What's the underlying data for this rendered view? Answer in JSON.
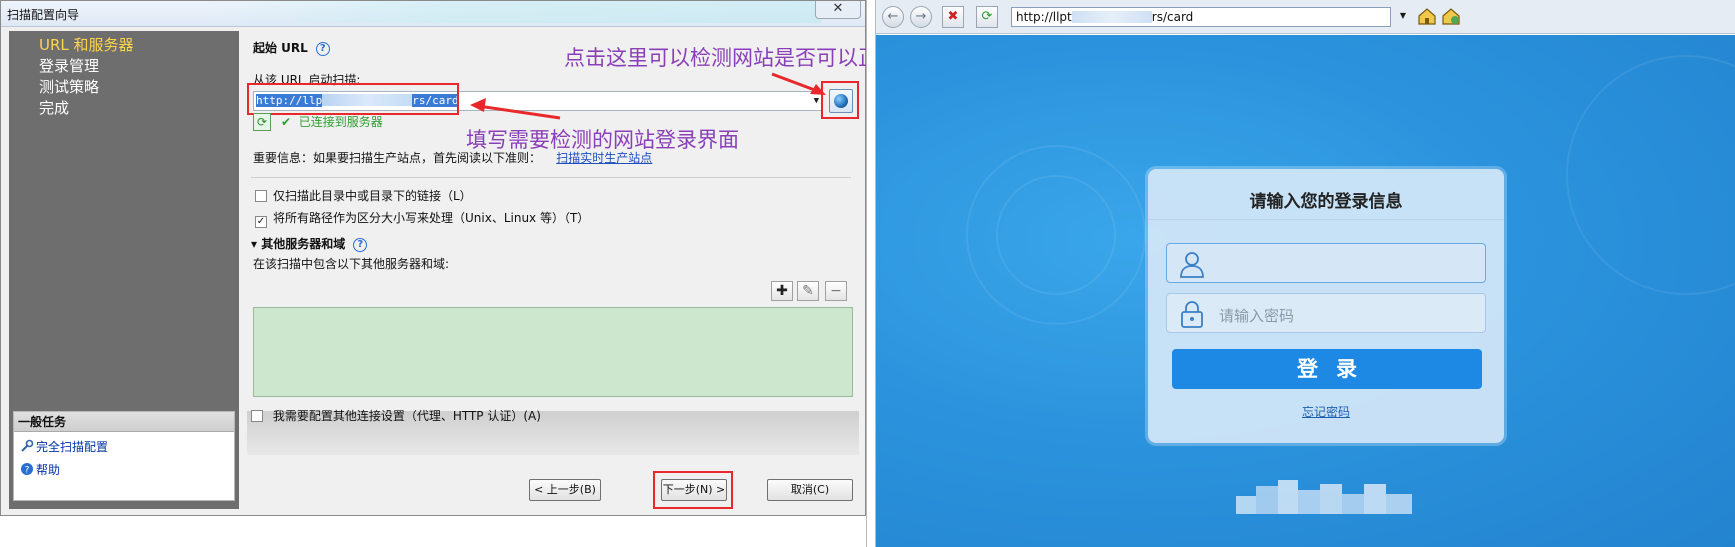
{
  "wizard": {
    "title": "扫描配置向导",
    "close_label": "✕",
    "steps": [
      "URL 和服务器",
      "登录管理",
      "测试策略",
      "完成"
    ],
    "general_tasks": {
      "header": "一般任务",
      "items": [
        {
          "label": "完全扫描配置",
          "icon": "wrench-icon"
        },
        {
          "label": "帮助",
          "icon": "help-icon"
        }
      ]
    },
    "start_url": {
      "heading": "起始 URL",
      "from_label": "从该 URL 启动扫描:",
      "url_prefix": "http://llp",
      "url_suffix": "rs/card",
      "connected_status": "已连接到服务器"
    },
    "important_info": {
      "text": "重要信息：如果要扫描生产站点，首先阅读以下准则：",
      "link": "扫描实时生产站点"
    },
    "options": [
      {
        "label": "仅扫描此目录中或目录下的链接（L）",
        "checked": false
      },
      {
        "label": "将所有路径作为区分大小写来处理（Unix、Linux 等）（T）",
        "checked": true
      }
    ],
    "other_servers": {
      "heading": "其他服务器和域",
      "description": "在该扫描中包含以下其他服务器和域:",
      "add_label": "✚",
      "edit_label": "✎",
      "remove_label": "−"
    },
    "connection_settings": {
      "label": "我需要配置其他连接设置（代理、HTTP 认证）(A)",
      "checked": false
    },
    "buttons": {
      "back": "< 上一步(B)",
      "next": "下一步(N) >",
      "cancel": "取消(C)"
    }
  },
  "annotations": {
    "test_connection": "点击这里可以检测网站是否可以正常连接",
    "fill_url": "填写需要检测的网站登录界面"
  },
  "browser": {
    "address_prefix": "http://llpt",
    "address_suffix": "rs/card",
    "nav": {
      "back": "←",
      "forward": "→",
      "stop": "✖",
      "refresh": "⟳"
    }
  },
  "login": {
    "title": "请输入您的登录信息",
    "username_placeholder": "",
    "password_placeholder": "请输入密码",
    "submit": "登录",
    "forgot": "忘记密码"
  },
  "colors": {
    "annotation": "#8a3fb8",
    "highlight": "#e8282b",
    "login_button": "#1e88e5",
    "page_background": "#2b93dd"
  }
}
